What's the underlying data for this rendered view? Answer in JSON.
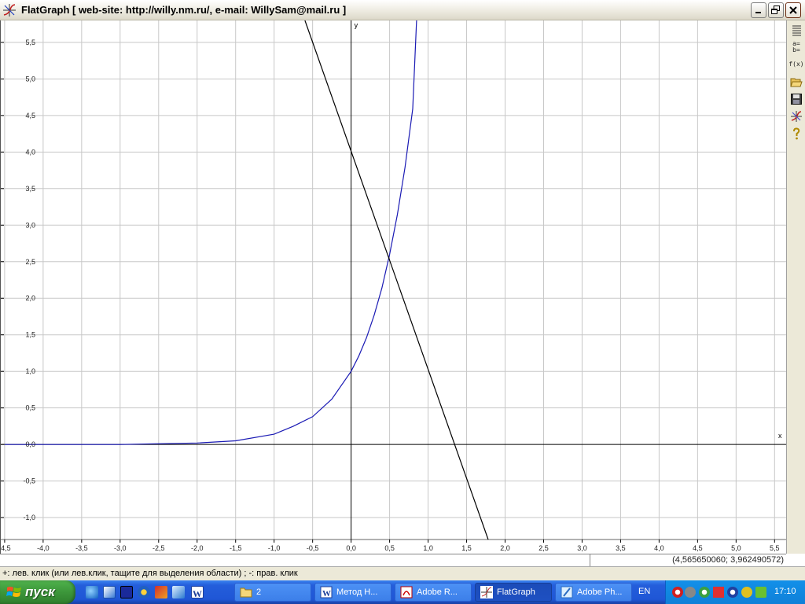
{
  "window": {
    "title": "FlatGraph [ web-site: http://willy.nm.ru/, e-mail: WillySam@mail.ru ]",
    "controls": [
      "minimize",
      "restore",
      "close"
    ]
  },
  "graph": {
    "axis_x_label": "x",
    "axis_y_label": "y",
    "x_ticks": [
      "-4,5",
      "-4,0",
      "-3,5",
      "-3,0",
      "-2,5",
      "-2,0",
      "-1,5",
      "-1,0",
      "-0,5",
      "0,0",
      "0,5",
      "1,0",
      "1,5",
      "2,0",
      "2,5",
      "3,0",
      "3,5",
      "4,0",
      "4,5",
      "5,0",
      "5,5"
    ],
    "y_ticks": [
      "5,5",
      "5,0",
      "4,5",
      "4,0",
      "3,5",
      "3,0",
      "2,5",
      "2,0",
      "1,5",
      "1,0",
      "0,5",
      "0,0",
      "-0,5",
      "-1,0"
    ],
    "colors": {
      "grid": "#c8c8c8",
      "axes": "#000000",
      "curve1": "#1a1ab4",
      "curve2": "#000000"
    }
  },
  "chart_data": {
    "type": "line",
    "title": "",
    "xlabel": "x",
    "ylabel": "y",
    "xlim": [
      -4.55,
      5.65
    ],
    "ylim": [
      -1.3,
      5.8
    ],
    "grid": true,
    "series": [
      {
        "color": "#1a1ab4",
        "x": [
          -4.5,
          -4.0,
          -3.5,
          -3.0,
          -2.5,
          -2.0,
          -1.5,
          -1.0,
          -0.75,
          -0.5,
          -0.25,
          0.0,
          0.1,
          0.2,
          0.3,
          0.4,
          0.5,
          0.6,
          0.7,
          0.8,
          0.85
        ],
        "y": [
          0.0,
          0.0,
          0.0,
          0.0,
          0.01,
          0.02,
          0.05,
          0.14,
          0.25,
          0.38,
          0.62,
          1.0,
          1.21,
          1.46,
          1.77,
          2.14,
          2.6,
          3.14,
          3.79,
          4.59,
          5.8
        ]
      },
      {
        "color": "#000000",
        "x": [
          -0.6,
          1.78
        ],
        "y": [
          5.8,
          -1.3
        ]
      }
    ]
  },
  "coordinates_readout": "(4,565650060; 3,962490572)",
  "status_text": "+: лев. клик (или лев.клик, тащите для выделения области) ; -: прав. клик",
  "toolbar": {
    "items": [
      {
        "name": "list-icon",
        "glyph": ""
      },
      {
        "name": "assign-icon",
        "glyph": "a=\nb="
      },
      {
        "name": "function-icon",
        "glyph": "f(x)"
      },
      {
        "name": "open-folder-icon",
        "glyph": ""
      },
      {
        "name": "save-icon",
        "glyph": ""
      },
      {
        "name": "graph-icon",
        "glyph": ""
      },
      {
        "name": "help-icon",
        "glyph": ""
      }
    ]
  },
  "taskbar": {
    "start_label": "пуск",
    "tasks": [
      {
        "label": "2",
        "icon": "folder-icon",
        "active": false
      },
      {
        "label": "Метод Н...",
        "icon": "word-icon",
        "active": false
      },
      {
        "label": "Adobe R...",
        "icon": "acrobat-icon",
        "active": false
      },
      {
        "label": "FlatGraph",
        "icon": "flatgraph-icon",
        "active": true
      },
      {
        "label": "Adobe Ph...",
        "icon": "photoshop-icon",
        "active": false
      }
    ],
    "language": "EN",
    "clock": "17:10"
  }
}
